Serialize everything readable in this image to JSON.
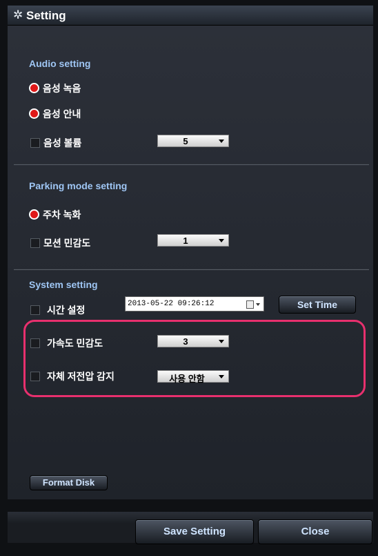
{
  "window": {
    "title": "Setting",
    "title_icon": "gear-icon"
  },
  "audio": {
    "title": "Audio setting",
    "record_voice": "음성 녹음",
    "voice_guide": "음성 안내",
    "voice_volume": "음성 볼륨",
    "volume_value": "5"
  },
  "parking": {
    "title": "Parking mode setting",
    "parking_record": "주차 녹화",
    "motion_sensitivity": "모션 민감도",
    "motion_value": "1"
  },
  "system": {
    "title": "System setting",
    "time_setting": "시간 설정",
    "datetime": "2013-05-22 09:26:12",
    "set_time": "Set Time",
    "accel_sensitivity": "가속도 민감도",
    "accel_value": "3",
    "low_voltage": "자체 저전압 감지",
    "low_voltage_value": "사용 안함"
  },
  "buttons": {
    "format_disk": "Format Disk",
    "save_setting": "Save Setting",
    "close": "Close"
  },
  "colors": {
    "accent_title": "#9fc6f4",
    "radio_selected": "#e01818",
    "highlight": "#e8306e"
  }
}
